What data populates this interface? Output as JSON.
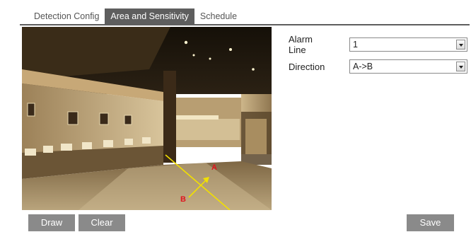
{
  "tabs": [
    {
      "label": "Detection Config",
      "active": false
    },
    {
      "label": "Area and Sensitivity",
      "active": true
    },
    {
      "label": "Schedule",
      "active": false
    }
  ],
  "video": {
    "markers": {
      "a": "A",
      "b": "B"
    },
    "line_color": "#f2e000",
    "marker_color": "#e0141e"
  },
  "form": {
    "alarm_line": {
      "label": "Alarm Line",
      "value": "1"
    },
    "direction": {
      "label": "Direction",
      "value": "A->B"
    }
  },
  "buttons": {
    "draw": "Draw",
    "clear": "Clear",
    "save": "Save"
  },
  "colors": {
    "tab_active_bg": "#5e5e5e",
    "button_bg": "#8a8a8a"
  }
}
